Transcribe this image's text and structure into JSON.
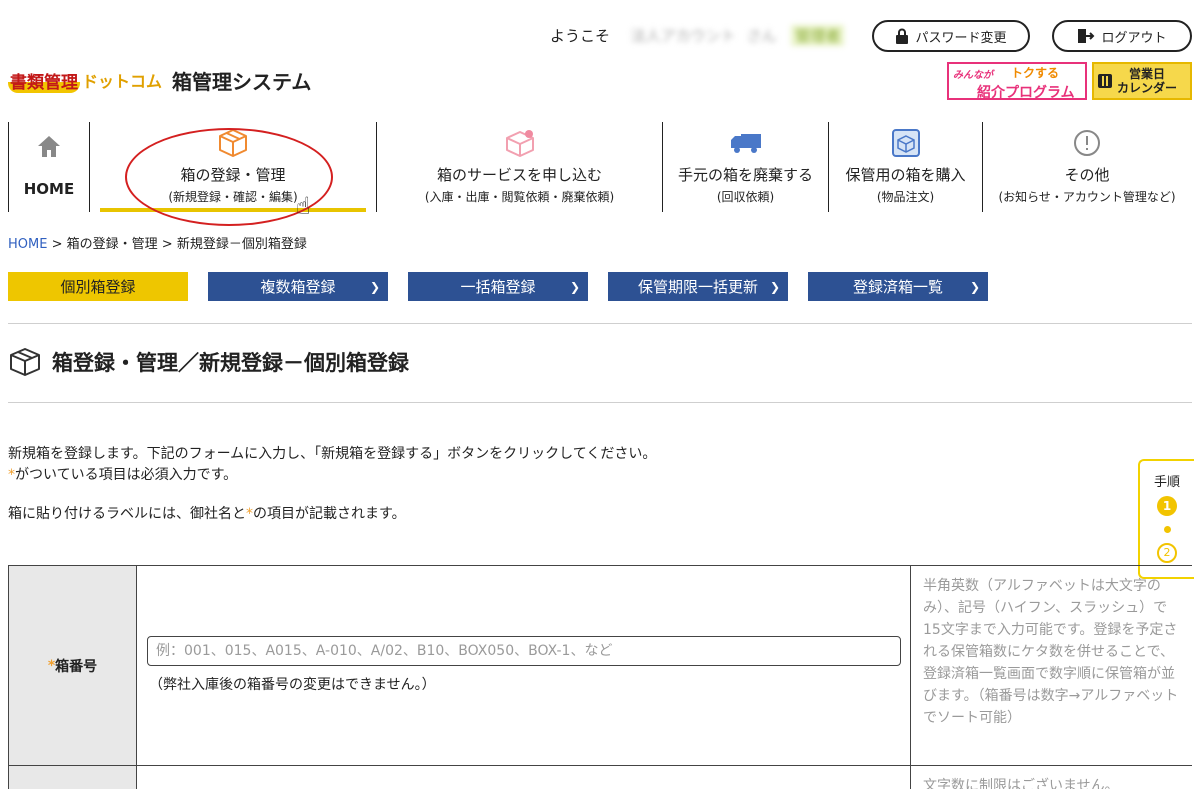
{
  "header": {
    "welcome": "ようこそ",
    "account_name": "法人アカウント",
    "san": "さん",
    "admin_badge": "管理者",
    "password_change": "パスワード変更",
    "logout": "ログアウト",
    "logo_main": "書類管理",
    "logo_dotcom": "ドットコム",
    "system_name": "箱管理システム",
    "promo_small": "みんなが",
    "promo_toku": "トクする",
    "promo_big": "紹介プログラム",
    "calendar_line1": "営業日",
    "calendar_line2": "カレンダー"
  },
  "nav": {
    "home": "HOME",
    "box_main": "箱の登録・管理",
    "box_sub": "(新規登録・確認・編集)",
    "service_main": "箱のサービスを申し込む",
    "service_sub": "(入庫・出庫・閲覧依頼・廃棄依頼)",
    "dispose_main": "手元の箱を廃棄する",
    "dispose_sub": "(回収依頼)",
    "buy_main": "保管用の箱を購入",
    "buy_sub": "(物品注文)",
    "other_main": "その他",
    "other_sub": "(お知らせ・アカウント管理など)"
  },
  "breadcrumb": {
    "home": "HOME",
    "sep1": " > ",
    "level1": "箱の登録・管理",
    "sep2": " > ",
    "level2": "新規登録－個別箱登録"
  },
  "tabs": [
    {
      "label": "個別箱登録"
    },
    {
      "label": "複数箱登録"
    },
    {
      "label": "一括箱登録"
    },
    {
      "label": "保管期限一括更新"
    },
    {
      "label": "登録済箱一覧"
    }
  ],
  "page": {
    "title": "箱登録・管理／新規登録－個別箱登録",
    "intro1": "新規箱を登録します。下記のフォームに入力し、「新規箱を登録する」ボタンをクリックしてください。",
    "intro2": "がついている項目は必須入力です。",
    "intro3a": "箱に貼り付けるラベルには、御社名と",
    "intro3b": "の項目が記載されます。",
    "asterisk": "*"
  },
  "steps": {
    "label": "手順",
    "step1": "1",
    "step2": "2"
  },
  "form": {
    "box_number_label": "箱番号",
    "box_number_placeholder": "例：001、015、A015、A-010、A/02、B10、BOX050、BOX-1、など",
    "box_number_note": "（弊社入庫後の箱番号の変更はできません。）",
    "box_number_help": "半角英数（アルファベットは大文字のみ）、記号（ハイフン、スラッシュ）で15文字まで入力可能です。登録を予定される保管箱数にケタ数を併せることで、登録済箱一覧画面で数字順に保管箱が並びます。（箱番号は数字→アルファベットでソート可能）",
    "row2_help": "文字数に制限はございません。"
  },
  "colors": {
    "accent_yellow": "#eec600",
    "tab_blue": "#2d5193",
    "annotation_red": "#d42020"
  }
}
